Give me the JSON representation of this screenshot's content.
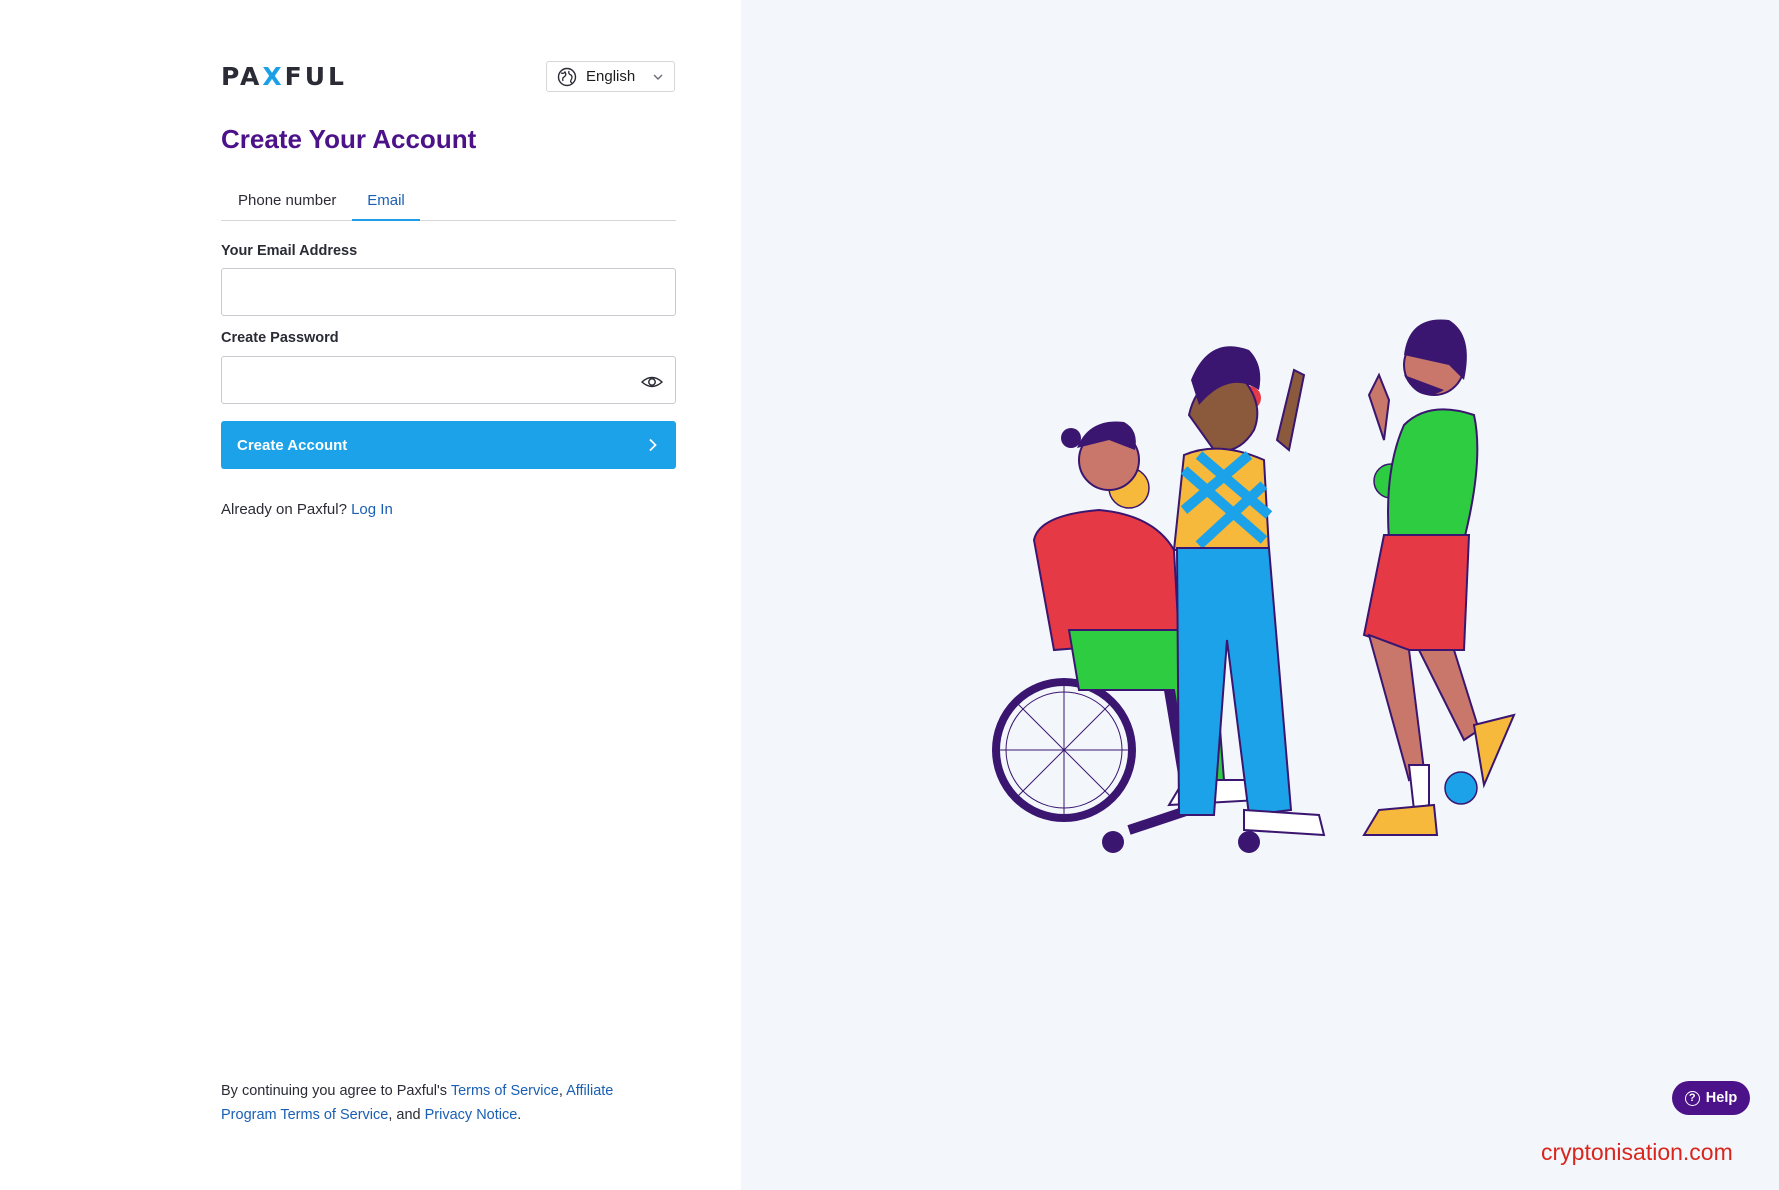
{
  "logo": {
    "left": "PA",
    "x": "X",
    "right": "FUL"
  },
  "language": {
    "selected": "English"
  },
  "title": "Create Your Account",
  "tabs": [
    {
      "label": "Phone number",
      "active": false
    },
    {
      "label": "Email",
      "active": true
    }
  ],
  "email": {
    "label": "Your Email Address",
    "value": "",
    "placeholder": ""
  },
  "password": {
    "label": "Create Password",
    "value": "",
    "placeholder": ""
  },
  "create_button": {
    "label": "Create Account"
  },
  "login_prompt": {
    "text": "Already on Paxful?",
    "link": "Log In"
  },
  "legal": {
    "prefix": "By continuing you agree to Paxful's",
    "terms": "Terms of Service",
    "comma": ",",
    "affiliate": "Affiliate Program Terms of Service",
    "and": ", and",
    "privacy": "Privacy Notice",
    "period": "."
  },
  "help_button": {
    "label": "Help"
  },
  "watermark": "cryptonisation.com",
  "colors": {
    "brand_purple": "#4c1289",
    "primary_blue": "#1ca2e8",
    "link_blue": "#1a5fb4",
    "panel_bg": "#f3f7fb"
  }
}
